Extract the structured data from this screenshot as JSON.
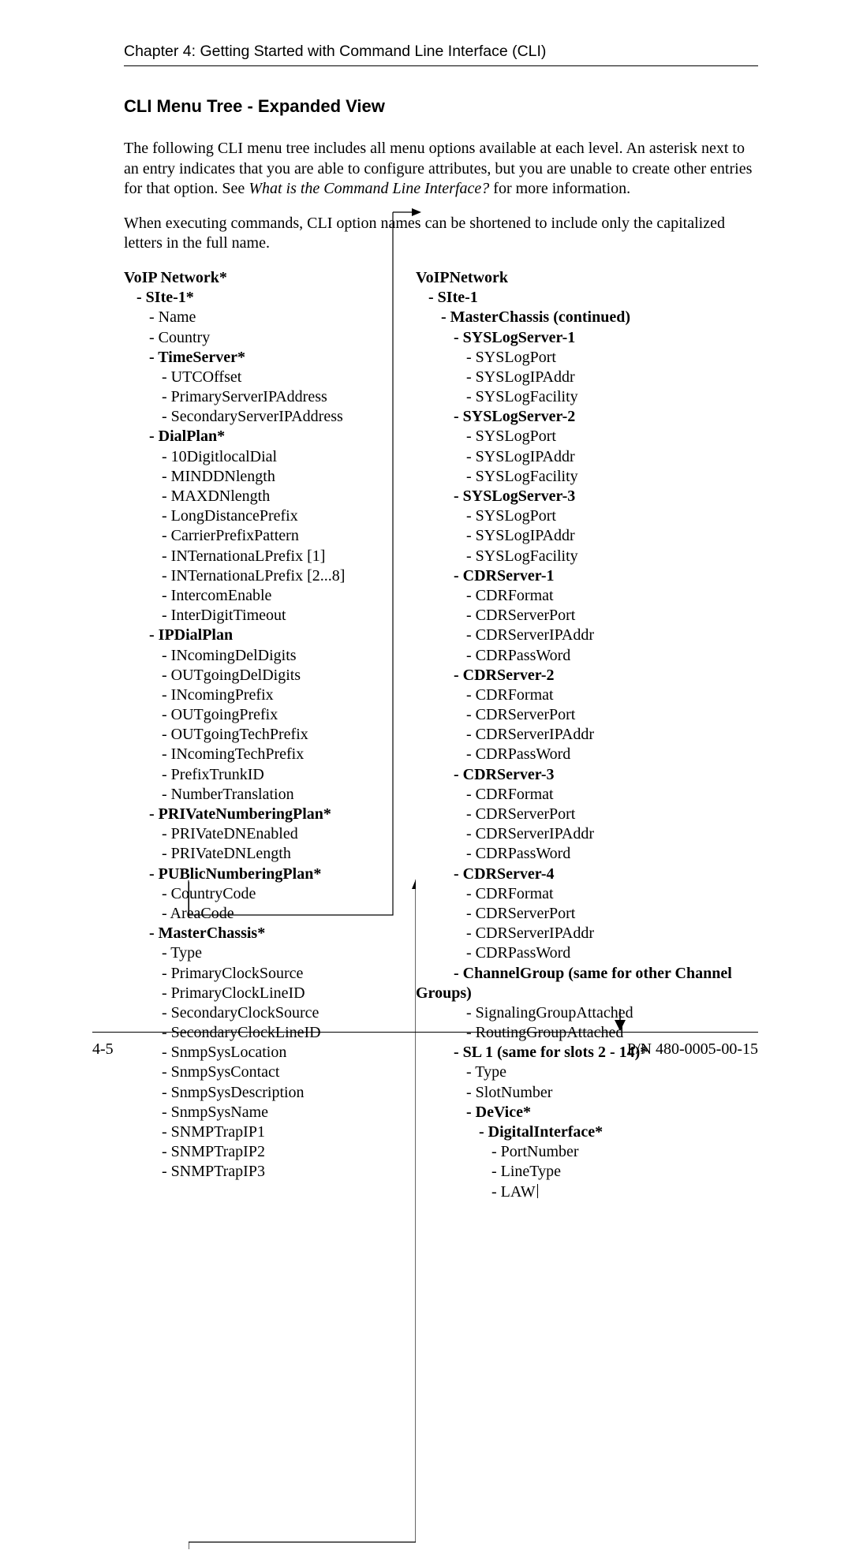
{
  "chapter_header": "Chapter 4: Getting Started with Command Line Interface (CLI)",
  "section_title": "CLI Menu Tree - Expanded View",
  "para1": "The following CLI menu tree includes all menu options available at each level. An asterisk next to an entry indicates that you are able to configure attributes, but you are unable to create other entries for that option. See ",
  "para1_italic": "What is the Command Line Interface?",
  "para1_tail": " for more information.",
  "para2": "When executing commands, CLI option names can be shortened to include only the capitalized letters in the full name.",
  "footer_left": "4-5",
  "footer_right": "P/N 480-0005-00-15",
  "left_tree": [
    {
      "lvl": 0,
      "bold": true,
      "text": "VoIP Network*"
    },
    {
      "lvl": 1,
      "bold": true,
      "text": "- SIte-1*"
    },
    {
      "lvl": 2,
      "bold": false,
      "text": "- Name"
    },
    {
      "lvl": 2,
      "bold": false,
      "text": "- Country"
    },
    {
      "lvl": 2,
      "bold": true,
      "text": "- TimeServer*"
    },
    {
      "lvl": 3,
      "bold": false,
      "text": "- UTCOffset"
    },
    {
      "lvl": 3,
      "bold": false,
      "text": "- PrimaryServerIPAddress"
    },
    {
      "lvl": 3,
      "bold": false,
      "text": "- SecondaryServerIPAddress"
    },
    {
      "lvl": 2,
      "bold": true,
      "text": "- DialPlan*"
    },
    {
      "lvl": 3,
      "bold": false,
      "text": "- 10DigitlocalDial"
    },
    {
      "lvl": 3,
      "bold": false,
      "text": "- MINDDNlength"
    },
    {
      "lvl": 3,
      "bold": false,
      "text": "- MAXDNlength"
    },
    {
      "lvl": 3,
      "bold": false,
      "text": "- LongDistancePrefix"
    },
    {
      "lvl": 3,
      "bold": false,
      "text": "- CarrierPrefixPattern"
    },
    {
      "lvl": 3,
      "bold": false,
      "text": "- INTernationaLPrefix [1]"
    },
    {
      "lvl": 3,
      "bold": false,
      "text": "- INTernationaLPrefix [2...8]"
    },
    {
      "lvl": 3,
      "bold": false,
      "text": "- IntercomEnable"
    },
    {
      "lvl": 3,
      "bold": false,
      "text": "- InterDigitTimeout"
    },
    {
      "lvl": 2,
      "bold": true,
      "text": "- IPDialPlan"
    },
    {
      "lvl": 3,
      "bold": false,
      "text": "- INcomingDelDigits"
    },
    {
      "lvl": 3,
      "bold": false,
      "text": "- OUTgoingDelDigits"
    },
    {
      "lvl": 3,
      "bold": false,
      "text": "- INcomingPrefix"
    },
    {
      "lvl": 3,
      "bold": false,
      "text": "- OUTgoingPrefix"
    },
    {
      "lvl": 3,
      "bold": false,
      "text": "- OUTgoingTechPrefix"
    },
    {
      "lvl": 3,
      "bold": false,
      "text": "- INcomingTechPrefix"
    },
    {
      "lvl": 3,
      "bold": false,
      "text": "- PrefixTrunkID"
    },
    {
      "lvl": 3,
      "bold": false,
      "text": "- NumberTranslation"
    },
    {
      "lvl": 2,
      "bold": true,
      "text": "- PRIVateNumberingPlan*"
    },
    {
      "lvl": 3,
      "bold": false,
      "text": "- PRIVateDNEnabled"
    },
    {
      "lvl": 3,
      "bold": false,
      "text": "- PRIVateDNLength"
    },
    {
      "lvl": 2,
      "bold": true,
      "text": "- PUBlicNumberingPlan*"
    },
    {
      "lvl": 3,
      "bold": false,
      "text": "- CountryCode"
    },
    {
      "lvl": 3,
      "bold": false,
      "text": "- AreaCode"
    },
    {
      "lvl": 2,
      "bold": true,
      "text": "- MasterChassis*"
    },
    {
      "lvl": 3,
      "bold": false,
      "text": "- Type"
    },
    {
      "lvl": 3,
      "bold": false,
      "text": "- PrimaryClockSource"
    },
    {
      "lvl": 3,
      "bold": false,
      "text": "- PrimaryClockLineID"
    },
    {
      "lvl": 3,
      "bold": false,
      "text": "- SecondaryClockSource"
    },
    {
      "lvl": 3,
      "bold": false,
      "text": "- SecondaryClockLineID"
    },
    {
      "lvl": 3,
      "bold": false,
      "text": "- SnmpSysLocation"
    },
    {
      "lvl": 3,
      "bold": false,
      "text": "- SnmpSysContact"
    },
    {
      "lvl": 3,
      "bold": false,
      "text": "- SnmpSysDescription"
    },
    {
      "lvl": 3,
      "bold": false,
      "text": "- SnmpSysName"
    },
    {
      "lvl": 3,
      "bold": false,
      "text": "- SNMPTrapIP1"
    },
    {
      "lvl": 3,
      "bold": false,
      "text": "- SNMPTrapIP2"
    },
    {
      "lvl": 3,
      "bold": false,
      "text": "- SNMPTrapIP3"
    }
  ],
  "right_tree": [
    {
      "lvl": 0,
      "bold": true,
      "text": "VoIPNetwork"
    },
    {
      "lvl": 1,
      "bold": true,
      "text": "- SIte-1"
    },
    {
      "lvl": 2,
      "bold": true,
      "text": "- MasterChassis (continued)"
    },
    {
      "lvl": 3,
      "bold": true,
      "text": "- SYSLogServer-1"
    },
    {
      "lvl": 4,
      "bold": false,
      "text": "- SYSLogPort"
    },
    {
      "lvl": 4,
      "bold": false,
      "text": "- SYSLogIPAddr"
    },
    {
      "lvl": 4,
      "bold": false,
      "text": "- SYSLogFacility"
    },
    {
      "lvl": 3,
      "bold": true,
      "text": "- SYSLogServer-2"
    },
    {
      "lvl": 4,
      "bold": false,
      "text": "- SYSLogPort"
    },
    {
      "lvl": 4,
      "bold": false,
      "text": "- SYSLogIPAddr"
    },
    {
      "lvl": 4,
      "bold": false,
      "text": "- SYSLogFacility"
    },
    {
      "lvl": 3,
      "bold": true,
      "text": "- SYSLogServer-3"
    },
    {
      "lvl": 4,
      "bold": false,
      "text": "- SYSLogPort"
    },
    {
      "lvl": 4,
      "bold": false,
      "text": "- SYSLogIPAddr"
    },
    {
      "lvl": 4,
      "bold": false,
      "text": "- SYSLogFacility"
    },
    {
      "lvl": 3,
      "bold": true,
      "text": "- CDRServer-1"
    },
    {
      "lvl": 4,
      "bold": false,
      "text": "- CDRFormat"
    },
    {
      "lvl": 4,
      "bold": false,
      "text": "- CDRServerPort"
    },
    {
      "lvl": 4,
      "bold": false,
      "text": "- CDRServerIPAddr"
    },
    {
      "lvl": 4,
      "bold": false,
      "text": "- CDRPassWord"
    },
    {
      "lvl": 3,
      "bold": true,
      "text": "- CDRServer-2"
    },
    {
      "lvl": 4,
      "bold": false,
      "text": "- CDRFormat"
    },
    {
      "lvl": 4,
      "bold": false,
      "text": "- CDRServerPort"
    },
    {
      "lvl": 4,
      "bold": false,
      "text": "- CDRServerIPAddr"
    },
    {
      "lvl": 4,
      "bold": false,
      "text": "- CDRPassWord"
    },
    {
      "lvl": 3,
      "bold": true,
      "text": "- CDRServer-3"
    },
    {
      "lvl": 4,
      "bold": false,
      "text": "- CDRFormat"
    },
    {
      "lvl": 4,
      "bold": false,
      "text": "- CDRServerPort"
    },
    {
      "lvl": 4,
      "bold": false,
      "text": "- CDRServerIPAddr"
    },
    {
      "lvl": 4,
      "bold": false,
      "text": "- CDRPassWord"
    },
    {
      "lvl": 3,
      "bold": true,
      "text": "- CDRServer-4"
    },
    {
      "lvl": 4,
      "bold": false,
      "text": "- CDRFormat"
    },
    {
      "lvl": 4,
      "bold": false,
      "text": "- CDRServerPort"
    },
    {
      "lvl": 4,
      "bold": false,
      "text": "- CDRServerIPAddr"
    },
    {
      "lvl": 4,
      "bold": false,
      "text": "- CDRPassWord"
    },
    {
      "lvl": 3,
      "bold": true,
      "text": "- ChannelGroup (same for other Channel"
    },
    {
      "lvl": -1,
      "bold": true,
      "text": "Groups)"
    },
    {
      "lvl": 4,
      "bold": false,
      "text": "- SignalingGroupAttached"
    },
    {
      "lvl": 4,
      "bold": false,
      "text": "- RoutingGroupAttached"
    },
    {
      "lvl": 3,
      "bold": true,
      "text": "- SL 1 (same for slots 2 - 14)*"
    },
    {
      "lvl": 4,
      "bold": false,
      "text": "- Type"
    },
    {
      "lvl": 4,
      "bold": false,
      "text": "- SlotNumber"
    },
    {
      "lvl": 4,
      "bold": true,
      "text": "- DeVice*"
    },
    {
      "lvl": 5,
      "bold": true,
      "text": "- DigitalInterface*"
    },
    {
      "lvl": 6,
      "bold": false,
      "text": "- PortNumber"
    },
    {
      "lvl": 6,
      "bold": false,
      "text": "- LineType"
    },
    {
      "lvl": 6,
      "bold": false,
      "text": "- LAW",
      "cursor": true
    }
  ]
}
